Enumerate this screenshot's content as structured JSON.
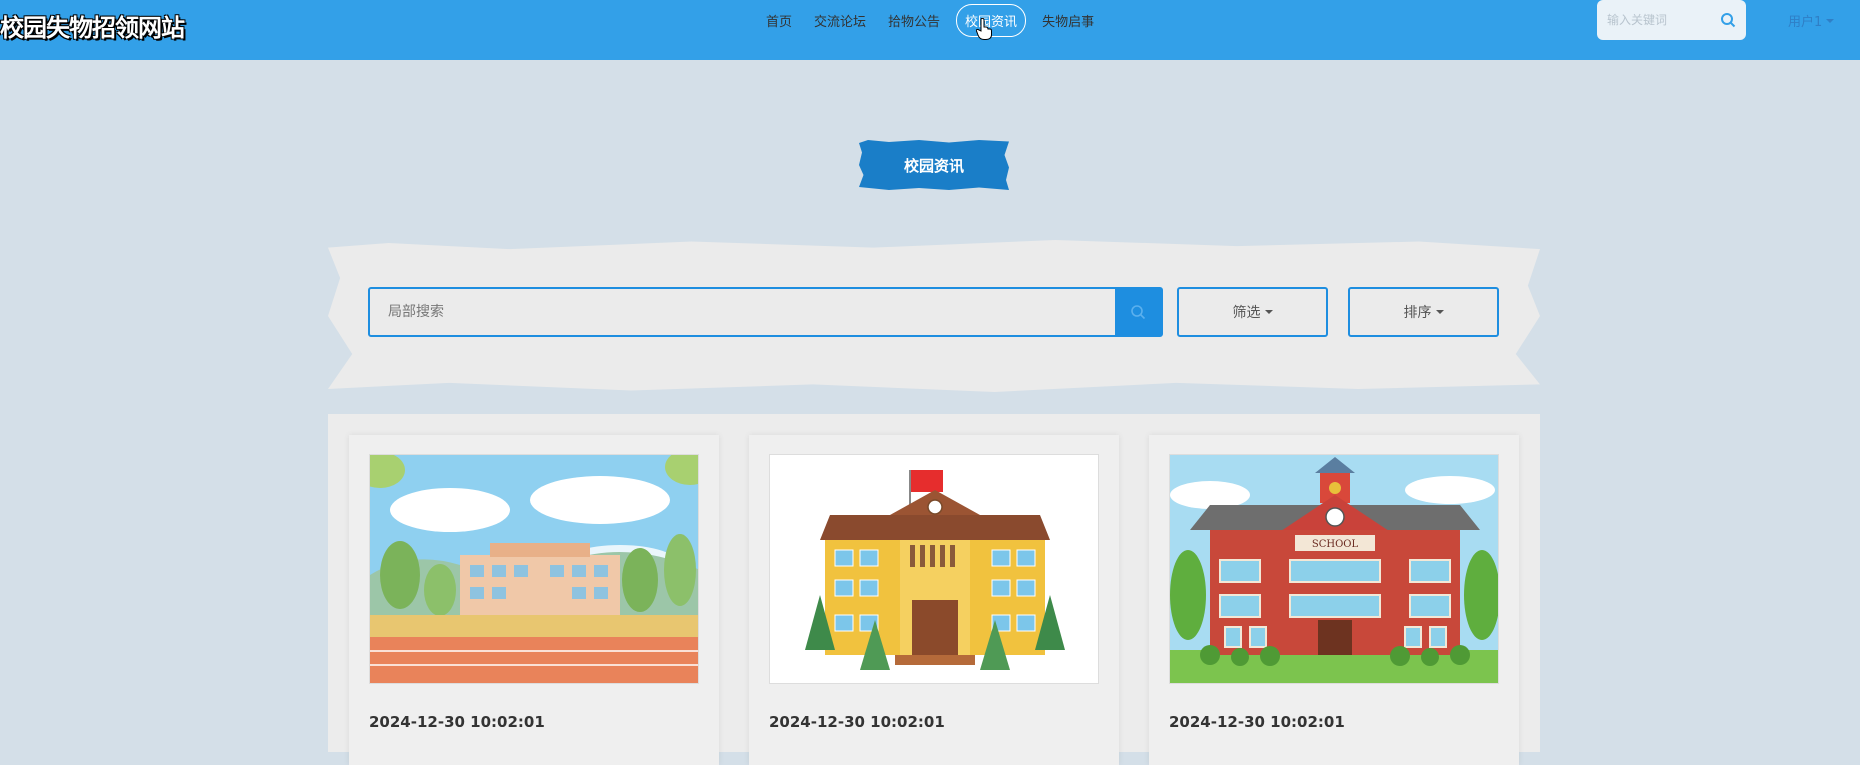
{
  "header": {
    "site_title": "校园失物招领网站",
    "nav": [
      "首页",
      "交流论坛",
      "拾物公告",
      "校园资讯",
      "失物启事"
    ],
    "active_nav": "校园资讯",
    "search_placeholder": "输入关键词",
    "user_label": "用户1",
    "bg_color": "#33a0e8"
  },
  "section": {
    "title": "校园资讯"
  },
  "filters": {
    "search_placeholder": "局部搜索",
    "filter_label": "筛选",
    "sort_label": "排序"
  },
  "cards": [
    {
      "date": "2024-12-30 10:02:01",
      "image": "campus-park-illustration"
    },
    {
      "date": "2024-12-30 10:02:01",
      "image": "yellow-school-building-flag"
    },
    {
      "date": "2024-12-30 10:02:01",
      "image": "red-school-building"
    }
  ],
  "icons": [
    "search-icon",
    "chevron-down-icon",
    "pointer-cursor-icon"
  ]
}
